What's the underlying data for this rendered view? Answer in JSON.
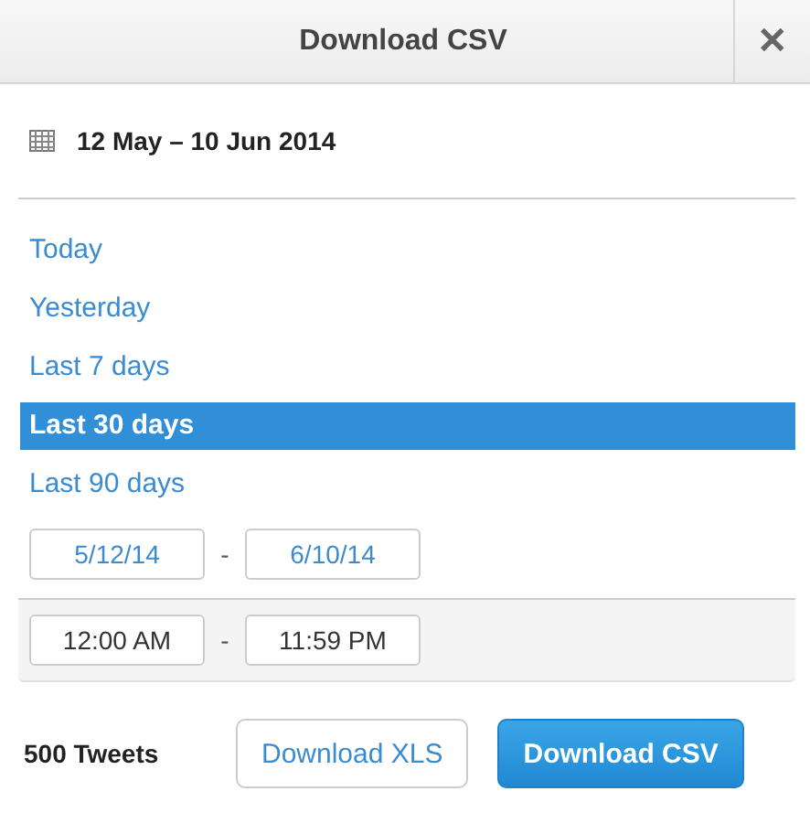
{
  "window": {
    "title": "Download CSV",
    "close": "✕"
  },
  "date_range": "12 May – 10 Jun 2014",
  "presets": [
    {
      "label": "Today",
      "selected": false
    },
    {
      "label": "Yesterday",
      "selected": false
    },
    {
      "label": "Last 7 days",
      "selected": false
    },
    {
      "label": "Last 30 days",
      "selected": true
    },
    {
      "label": "Last 90 days",
      "selected": false
    }
  ],
  "dates": {
    "start": "5/12/14",
    "separator": "-",
    "end": "6/10/14"
  },
  "times": {
    "start": "12:00 AM",
    "separator": "-",
    "end": "11:59 PM"
  },
  "footer": {
    "count": "500 Tweets",
    "buttons": [
      "Download XLS",
      "Download CSV"
    ]
  }
}
